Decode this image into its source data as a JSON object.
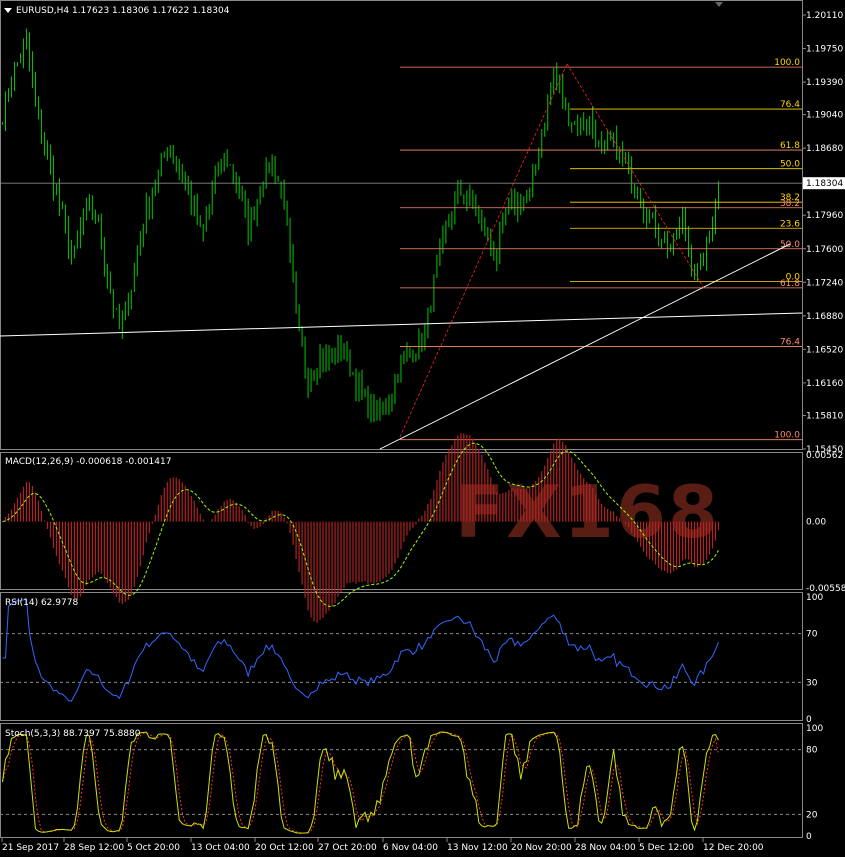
{
  "chart_data": [
    {
      "type": "candlestick",
      "title": "EURUSD,H4  1.17623 1.18306 1.17622 1.18304",
      "ylim": [
        1.1545,
        1.2011
      ],
      "yticks": [
        "1.20110",
        "1.19750",
        "1.19390",
        "1.19040",
        "1.18680",
        "1.17960",
        "1.17600",
        "1.17240",
        "1.16880",
        "1.16520",
        "1.16160",
        "1.15810",
        "1.15450"
      ],
      "ytick_values": [
        1.2011,
        1.1975,
        1.1939,
        1.1904,
        1.1868,
        1.1796,
        1.176,
        1.1724,
        1.1688,
        1.1652,
        1.1616,
        1.1581,
        1.1545
      ],
      "current_price": "1.18304",
      "current_price_value": 1.18304,
      "x": [
        "21 Sep 2017",
        "28 Sep 12:00",
        "5 Oct 20:00",
        "13 Oct 04:00",
        "20 Oct 12:00",
        "27 Oct 20:00",
        "6 Nov 04:00",
        "13 Nov 12:00",
        "20 Nov 20:00",
        "28 Nov 04:00",
        "5 Dec 12:00",
        "12 Dec 20:00"
      ],
      "series": [
        {
          "values": [
            1.1905,
            1.195,
            1.1985,
            1.19,
            1.185,
            1.18,
            1.1745,
            1.18,
            1.1795,
            1.1725,
            1.167,
            1.172,
            1.179,
            1.183,
            1.187,
            1.1845,
            1.1815,
            1.177,
            1.183,
            1.186,
            1.183,
            1.178,
            1.183,
            1.1855,
            1.181,
            1.1685,
            1.162,
            1.1645,
            1.164,
            1.1655,
            1.162,
            1.1595,
            1.158,
            1.16,
            1.164,
            1.165,
            1.167,
            1.174,
            1.179,
            1.182,
            1.181,
            1.178,
            1.175,
            1.18,
            1.181,
            1.182,
            1.189,
            1.195,
            1.191,
            1.189,
            1.19,
            1.186,
            1.1875,
            1.185,
            1.183,
            1.1795,
            1.1775,
            1.176,
            1.179,
            1.173,
            1.176,
            1.183
          ]
        }
      ],
      "fib_levels": [
        {
          "label": "100.0",
          "price": 1.1955,
          "color": "#ff8b6b",
          "label_color": "#ffd700"
        },
        {
          "label": "76.4",
          "price": 1.191,
          "color": "#ffd700",
          "label_color": "#ffd700"
        },
        {
          "label": "61.8",
          "price": 1.1866,
          "color": "#ff8b6b",
          "label_color": "#ffd700"
        },
        {
          "label": "50.0",
          "price": 1.1846,
          "color": "#ffd700",
          "label_color": "#ffd700"
        },
        {
          "label": "38.2",
          "price": 1.181,
          "color": "#ffd700",
          "label_color": "#ffd700"
        },
        {
          "label": "38.2",
          "price": 1.1804,
          "color": "#ff8b6b",
          "label_color": "#ff8b6b"
        },
        {
          "label": "23.6",
          "price": 1.1782,
          "color": "#ffd700",
          "label_color": "#ffd700"
        },
        {
          "label": "50.0",
          "price": 1.176,
          "color": "#ff8b6b",
          "label_color": "#ff8b6b"
        },
        {
          "label": "0.0",
          "price": 1.1725,
          "color": "#ffd700",
          "label_color": "#ffd700"
        },
        {
          "label": "61.8",
          "price": 1.1718,
          "color": "#ff8b6b",
          "label_color": "#ff8b6b"
        },
        {
          "label": "76.4",
          "price": 1.1655,
          "color": "#ff8b6b",
          "label_color": "#ff8b6b"
        },
        {
          "label": "100.0",
          "price": 1.1555,
          "color": "#ff8b6b",
          "label_color": "#ff8b6b"
        }
      ],
      "trendlines": [
        {
          "from": [
            "21 Sep 2017",
            1.1655
          ],
          "to": [
            "end",
            1.1688
          ],
          "color": "#ffffff"
        },
        {
          "from": [
            "6 Nov 04:00",
            1.1545
          ],
          "to": [
            "end",
            1.176
          ],
          "color": "#ffffff"
        }
      ],
      "colors": {
        "bull": "#00c800",
        "bear": "#00c800",
        "background": "#000000",
        "grid": "#666666"
      }
    },
    {
      "type": "bar",
      "title": "MACD(12,26,9) -0.000618 -0.001417",
      "ylim": [
        -0.005588,
        0.00562
      ],
      "yticks": [
        "0.00562",
        "0.00",
        "-0.005588"
      ],
      "ytick_values": [
        0.00562,
        0.0,
        -0.005588
      ],
      "colors": {
        "histogram": "#b22222",
        "signal": "#9aff00"
      }
    },
    {
      "type": "line",
      "title": "RSI(14) 62.9778",
      "ylim": [
        0,
        100
      ],
      "yticks": [
        "100",
        "70",
        "30",
        "0"
      ],
      "ytick_values": [
        100,
        70,
        30,
        0
      ],
      "levels": [
        70,
        30
      ],
      "current_value": 62.9778,
      "colors": {
        "line": "#3366ff"
      }
    },
    {
      "type": "line",
      "title": "Stoch(5,3,3) 88.7397 75.8880",
      "ylim": [
        0,
        100
      ],
      "yticks": [
        "100",
        "80",
        "20",
        "0"
      ],
      "ytick_values": [
        100,
        80,
        20,
        0
      ],
      "levels": [
        80,
        20
      ],
      "series": [
        {
          "name": "main",
          "current_value": 88.7397
        },
        {
          "name": "signal",
          "current_value": 75.888
        }
      ],
      "colors": {
        "main": "#c8e600",
        "signal": "#ff3030"
      }
    }
  ],
  "watermark": {
    "text": "FX168"
  }
}
